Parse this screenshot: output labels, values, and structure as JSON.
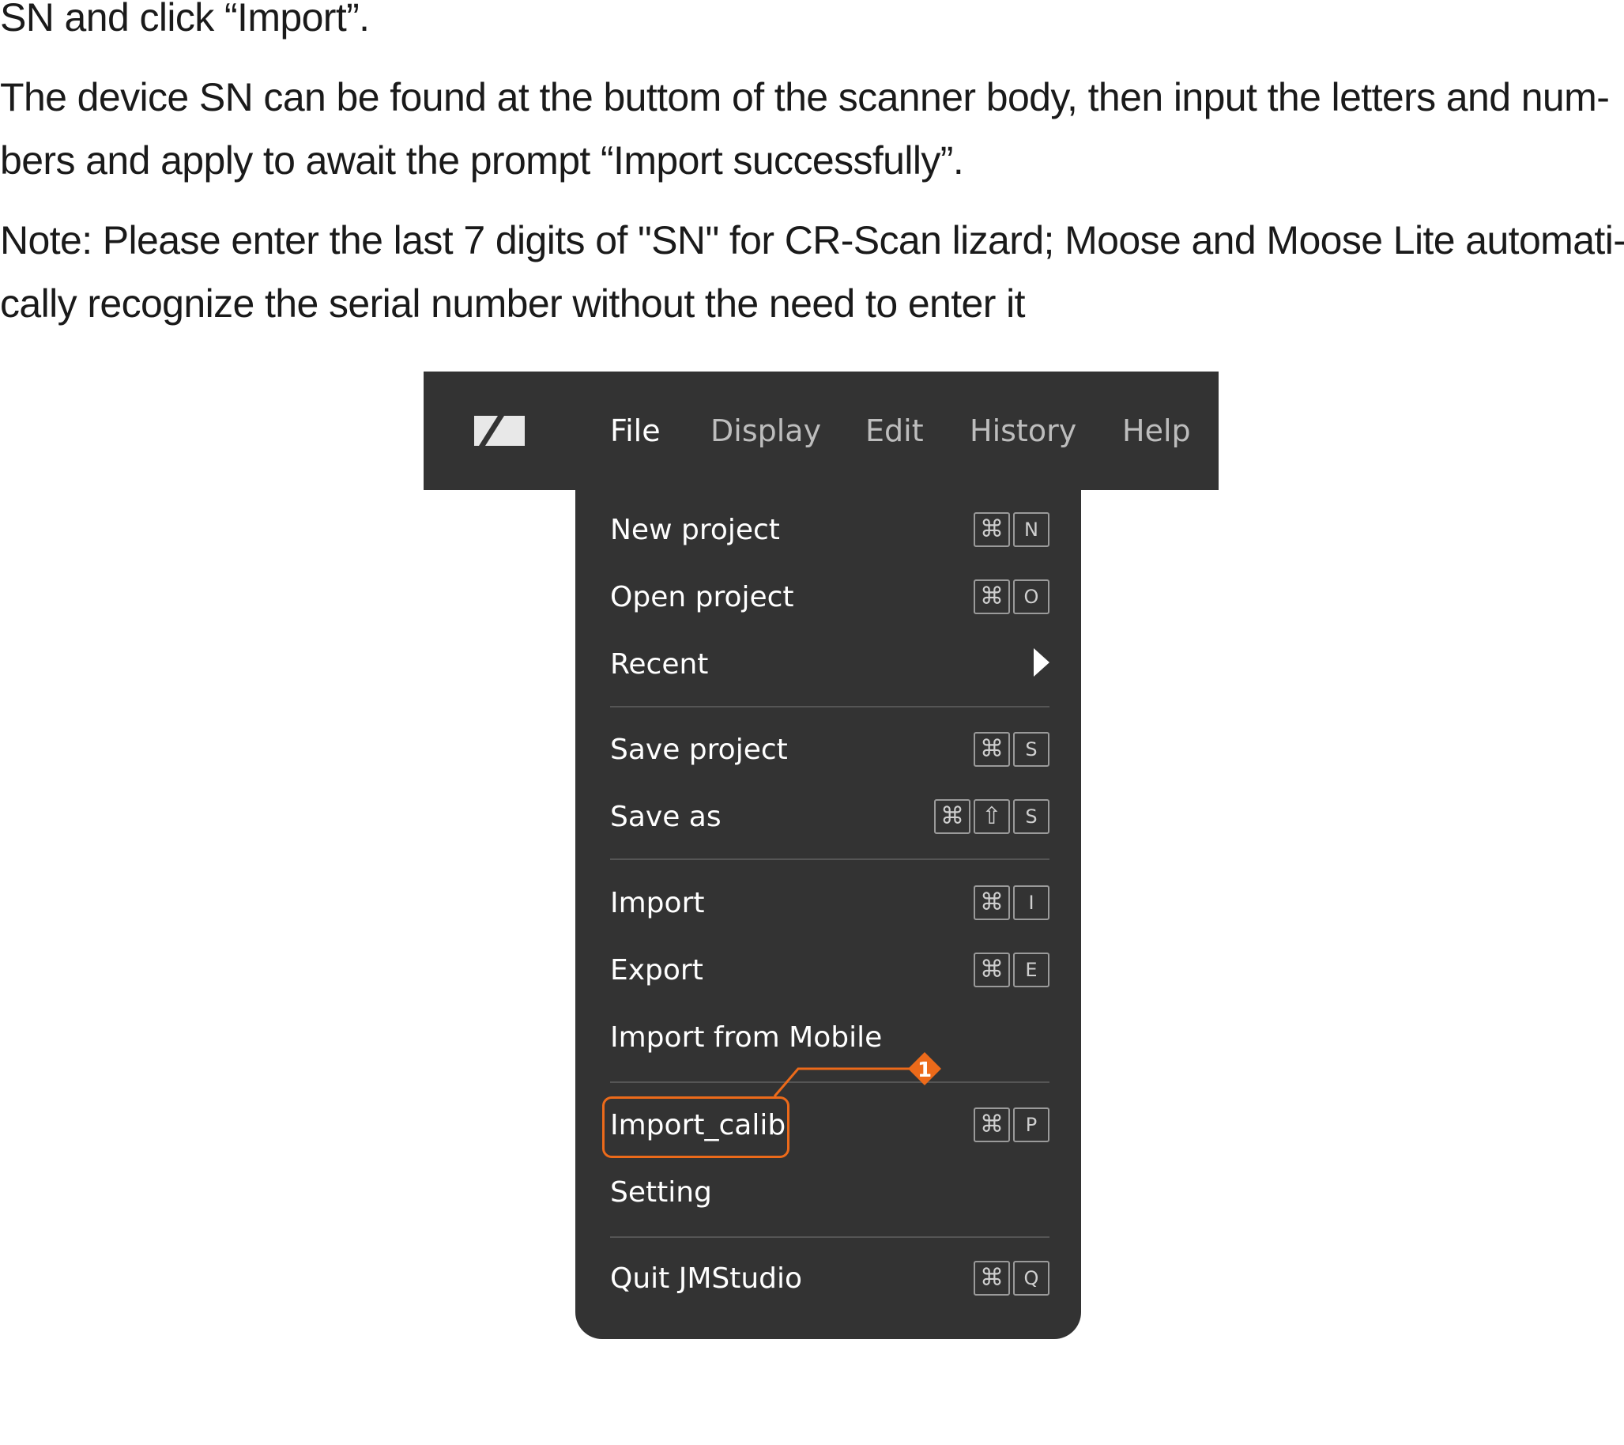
{
  "instructions": {
    "line0": "SN and click “Import”.",
    "line1a": "The device SN can be found at the buttom of the scanner body, then input the letters and num-",
    "line1b": "bers and apply to await the prompt “Import successfully”.",
    "line2a": "Note: Please enter the last 7 digits of \"SN\" for CR-Scan lizard; Moose and Moose Lite automati-",
    "line2b": "cally recognize the serial number without the need to enter it"
  },
  "menubar": {
    "logo": "app-logo",
    "menus": [
      "File",
      "Display",
      "Edit",
      "History",
      "Help"
    ],
    "active_menu": "File"
  },
  "dropdown": {
    "items": [
      {
        "label": "New project",
        "keys": [
          "⌘",
          "N"
        ]
      },
      {
        "label": "Open project",
        "keys": [
          "⌘",
          "O"
        ]
      },
      {
        "label": "Recent",
        "submenu_icon": "chevron-right-icon"
      },
      {
        "label": "Save project",
        "keys": [
          "⌘",
          "S"
        ]
      },
      {
        "label": "Save as",
        "keys": [
          "⌘",
          "⇧",
          "S"
        ]
      },
      {
        "label": "Import",
        "keys": [
          "⌘",
          "I"
        ]
      },
      {
        "label": "Export",
        "keys": [
          "⌘",
          "E"
        ]
      },
      {
        "label": "Import from Mobile"
      },
      {
        "label": "Import_calib",
        "keys": [
          "⌘",
          "P"
        ],
        "highlighted": true
      },
      {
        "label": "Setting"
      },
      {
        "label": "Quit JMStudio",
        "keys": [
          "⌘",
          "Q"
        ]
      }
    ]
  },
  "callout": {
    "number": "1",
    "color": "#ec6a1a"
  },
  "colors": {
    "menu_background": "#333333",
    "highlight": "#ec6a1a",
    "text_on_dark": "#ffffff",
    "inactive_menu_text": "#bdbdbd"
  }
}
